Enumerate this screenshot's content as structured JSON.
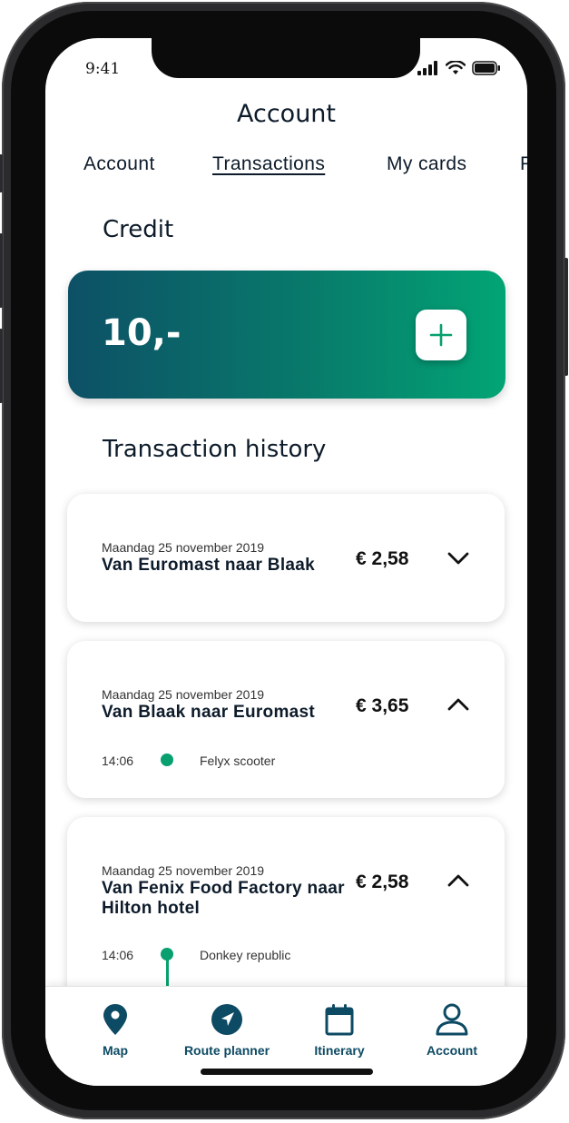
{
  "status_bar": {
    "time": "9:41"
  },
  "header": {
    "title": "Account"
  },
  "tabs": [
    {
      "label": "Account",
      "active": false
    },
    {
      "label": "Transactions",
      "active": true
    },
    {
      "label": "My cards",
      "active": false
    },
    {
      "label": "P",
      "active": false
    }
  ],
  "credit": {
    "section_title": "Credit",
    "amount": "10,-",
    "add_icon": "plus-icon",
    "gradient": [
      "#0d5066",
      "#02a575"
    ]
  },
  "history": {
    "section_title": "Transaction history",
    "transactions": [
      {
        "date": "Maandag 25 november 2019",
        "route": "Van Euromast naar Blaak",
        "price": "€ 2,58",
        "chevron": "chevron-down-icon",
        "segments": []
      },
      {
        "date": "Maandag 25 november 2019",
        "route": "Van Blaak naar Euromast",
        "price": "€ 3,65",
        "chevron": "chevron-up-icon",
        "segments": [
          {
            "time": "14:06",
            "provider": "Felyx scooter"
          }
        ]
      },
      {
        "date": "Maandag 25 november 2019",
        "route": "Van Fenix Food Factory naar Hilton hotel",
        "price": "€ 2,58",
        "chevron": "chevron-up-icon",
        "segments": [
          {
            "time": "14:06",
            "provider": "Donkey republic"
          }
        ]
      }
    ]
  },
  "bottom_nav": [
    {
      "label": "Map",
      "icon": "map-pin-icon"
    },
    {
      "label": "Route planner",
      "icon": "compass-navigation-icon"
    },
    {
      "label": "Itinerary",
      "icon": "calendar-icon"
    },
    {
      "label": "Account",
      "icon": "user-icon"
    }
  ],
  "colors": {
    "accent_green": "#07a06e",
    "nav_blue": "#0d4a63",
    "text_dark": "#0d1b2a"
  }
}
